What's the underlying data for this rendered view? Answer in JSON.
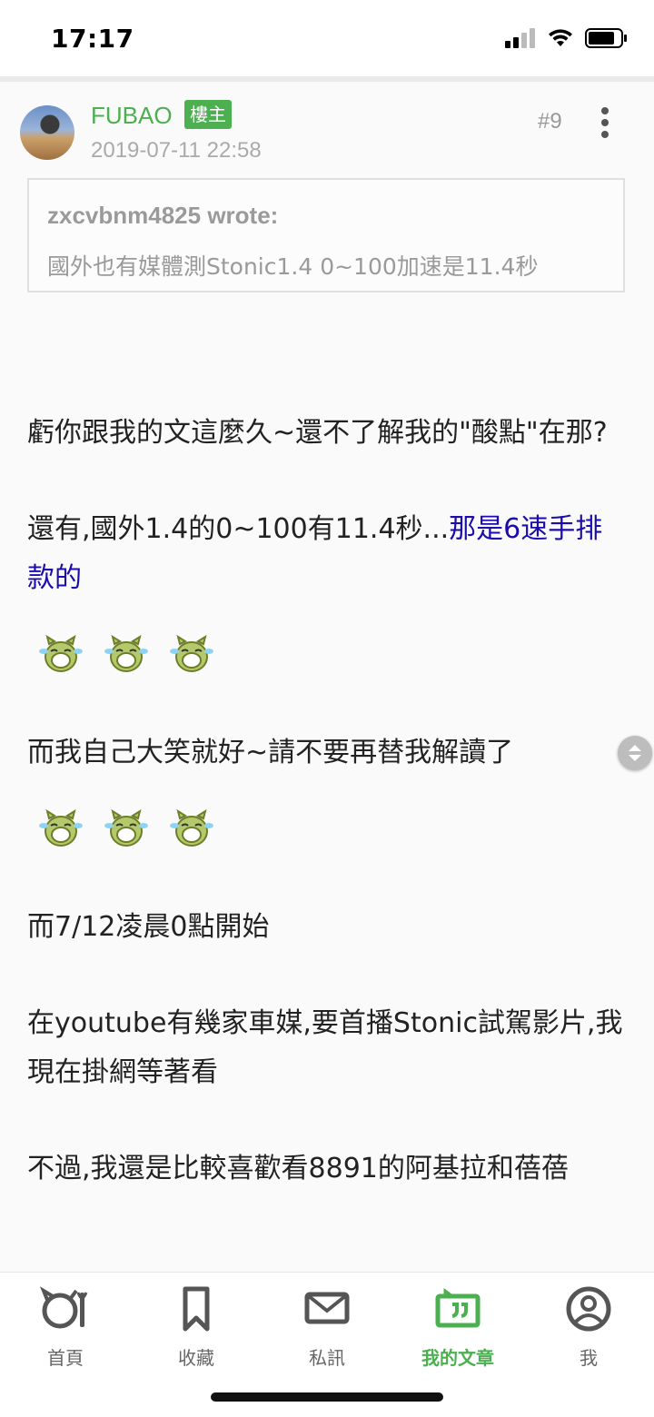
{
  "status_bar": {
    "time": "17:17"
  },
  "post": {
    "username": "FUBAO",
    "owner_badge": "樓主",
    "date": "2019-07-11 22:58",
    "number": "#9",
    "quote": {
      "author": "zxcvbnm4825 wrote:",
      "text": "國外也有媒體測Stonic1.4 0~100加速是11.4秒"
    },
    "paragraphs": {
      "p1": "虧你跟我的文這麼久~還不了解我的\"酸點\"在那?",
      "p2_text": "還有,國外1.4的0~100有11.4秒...",
      "p2_link": "那是6速手排款的",
      "p3": "而我自己大笑就好~請不要再替我解讀了",
      "p4": "而7/12凌晨0點開始",
      "p5": "在youtube有幾家車媒,要首播Stonic試駕影片,我現在掛網等著看",
      "p6": "不過,我還是比較喜歡看8891的阿基拉和蓓蓓"
    },
    "emoji_icon": "laughing-crying-emoji-icon"
  },
  "tab_bar": {
    "items": [
      {
        "label": "首頁",
        "icon": "home-icon"
      },
      {
        "label": "收藏",
        "icon": "bookmark-icon"
      },
      {
        "label": "私訊",
        "icon": "mail-icon"
      },
      {
        "label": "我的文章",
        "icon": "quote-icon"
      },
      {
        "label": "我",
        "icon": "profile-icon"
      }
    ],
    "active_index": 3
  },
  "colors": {
    "accent": "#4caf50",
    "link": "#1a0dab",
    "muted": "#9a9a9a"
  }
}
